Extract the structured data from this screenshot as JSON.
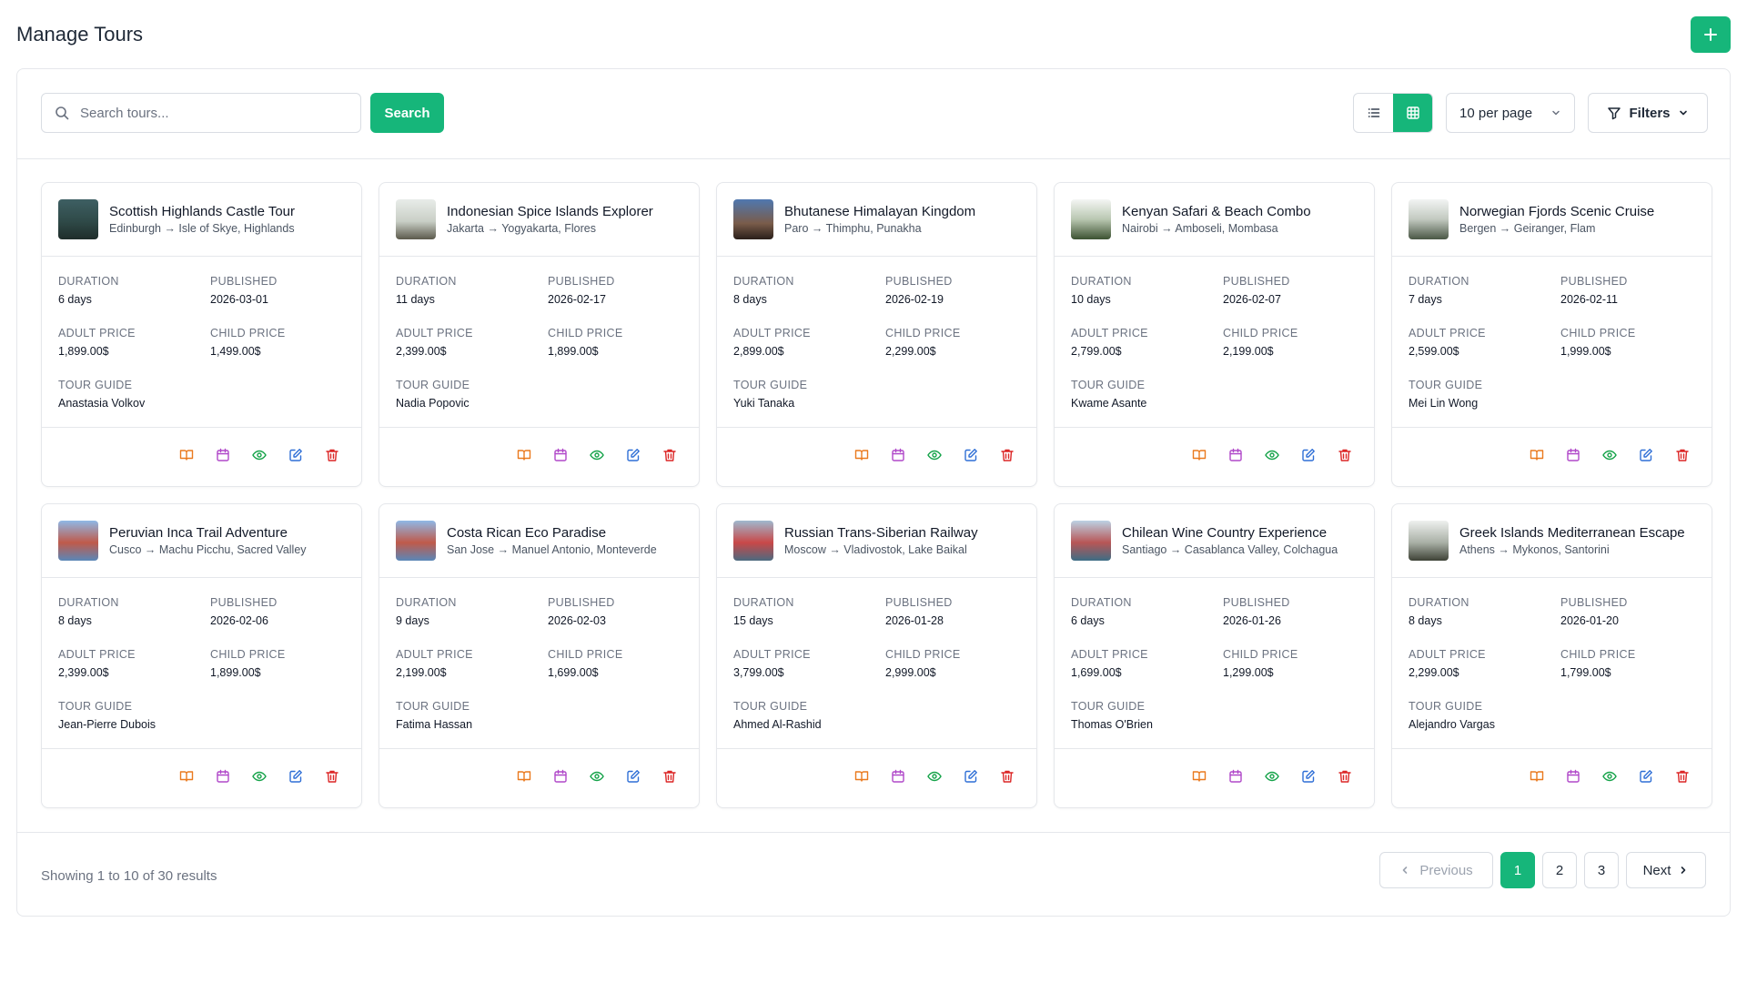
{
  "page": {
    "title": "Manage Tours",
    "add_icon": "plus-icon"
  },
  "toolbar": {
    "search_placeholder": "Search tours...",
    "search_value": "",
    "search_label": "Search",
    "view_modes": [
      "list",
      "grid"
    ],
    "active_view": "grid",
    "per_page": "10 per page",
    "filters_label": "Filters"
  },
  "labels": {
    "duration": "DURATION",
    "published": "PUBLISHED",
    "adult_price": "ADULT PRICE",
    "child_price": "CHILD PRICE",
    "tour_guide": "TOUR GUIDE"
  },
  "actions": [
    {
      "name": "book-icon",
      "color": "#ea7a1e"
    },
    {
      "name": "calendar-icon",
      "color": "#b048c9"
    },
    {
      "name": "eye-icon",
      "color": "#16a34a"
    },
    {
      "name": "edit-icon",
      "color": "#2f6fd6"
    },
    {
      "name": "trash-icon",
      "color": "#dc2626"
    }
  ],
  "tours": [
    {
      "title": "Scottish Highlands Castle Tour",
      "route": "Edinburgh → Isle of Skye, Highlands",
      "duration": "6 days",
      "published": "2026-03-01",
      "adult_price": "1,899.00$",
      "child_price": "1,499.00$",
      "guide": "Anastasia Volkov"
    },
    {
      "title": "Indonesian Spice Islands Explorer",
      "route": "Jakarta → Yogyakarta, Flores",
      "duration": "11 days",
      "published": "2026-02-17",
      "adult_price": "2,399.00$",
      "child_price": "1,899.00$",
      "guide": "Nadia Popovic"
    },
    {
      "title": "Bhutanese Himalayan Kingdom",
      "route": "Paro → Thimphu, Punakha",
      "duration": "8 days",
      "published": "2026-02-19",
      "adult_price": "2,899.00$",
      "child_price": "2,299.00$",
      "guide": "Yuki Tanaka"
    },
    {
      "title": "Kenyan Safari & Beach Combo",
      "route": "Nairobi → Amboseli, Mombasa",
      "duration": "10 days",
      "published": "2026-02-07",
      "adult_price": "2,799.00$",
      "child_price": "2,199.00$",
      "guide": "Kwame Asante"
    },
    {
      "title": "Norwegian Fjords Scenic Cruise",
      "route": "Bergen → Geiranger, Flam",
      "duration": "7 days",
      "published": "2026-02-11",
      "adult_price": "2,599.00$",
      "child_price": "1,999.00$",
      "guide": "Mei Lin Wong"
    },
    {
      "title": "Peruvian Inca Trail Adventure",
      "route": "Cusco → Machu Picchu, Sacred Valley",
      "duration": "8 days",
      "published": "2026-02-06",
      "adult_price": "2,399.00$",
      "child_price": "1,899.00$",
      "guide": "Jean-Pierre Dubois"
    },
    {
      "title": "Costa Rican Eco Paradise",
      "route": "San Jose → Manuel Antonio, Monteverde",
      "duration": "9 days",
      "published": "2026-02-03",
      "adult_price": "2,199.00$",
      "child_price": "1,699.00$",
      "guide": "Fatima Hassan"
    },
    {
      "title": "Russian Trans-Siberian Railway",
      "route": "Moscow → Vladivostok, Lake Baikal",
      "duration": "15 days",
      "published": "2026-01-28",
      "adult_price": "3,799.00$",
      "child_price": "2,999.00$",
      "guide": "Ahmed Al-Rashid"
    },
    {
      "title": "Chilean Wine Country Experience",
      "route": "Santiago → Casablanca Valley, Colchagua",
      "duration": "6 days",
      "published": "2026-01-26",
      "adult_price": "1,699.00$",
      "child_price": "1,299.00$",
      "guide": "Thomas O'Brien"
    },
    {
      "title": "Greek Islands Mediterranean Escape",
      "route": "Athens → Mykonos, Santorini",
      "duration": "8 days",
      "published": "2026-01-20",
      "adult_price": "2,299.00$",
      "child_price": "1,799.00$",
      "guide": "Alejandro Vargas"
    }
  ],
  "pagination": {
    "summary": "Showing 1 to 10 of 30 results",
    "previous": "Previous",
    "next": "Next",
    "pages": [
      "1",
      "2",
      "3"
    ],
    "current": "1"
  },
  "colors": {
    "accent": "#16b67a"
  }
}
